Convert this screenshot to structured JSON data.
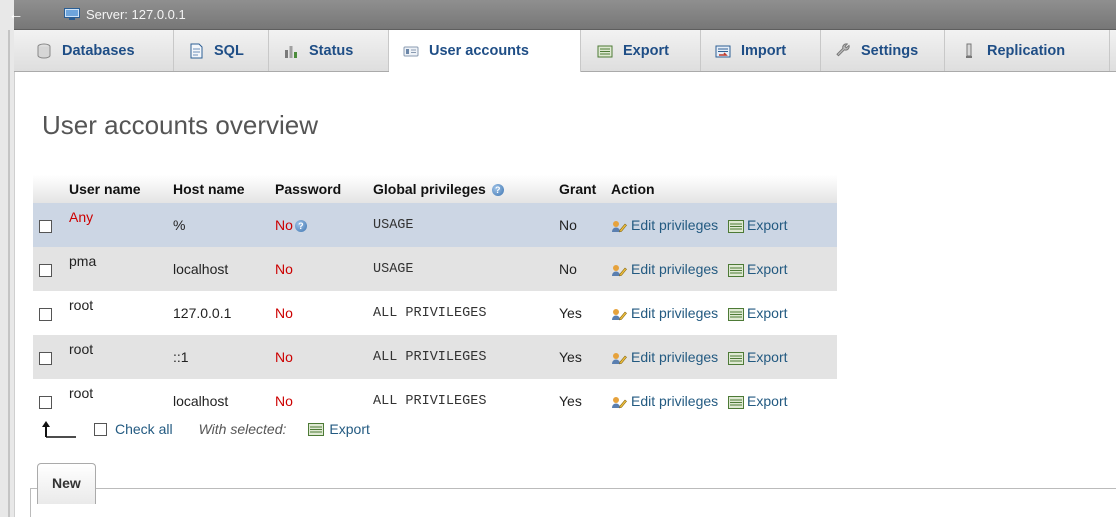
{
  "topbar": {
    "back_label": "←",
    "server_label": "Server: 127.0.0.1"
  },
  "tabs": [
    {
      "label": "Databases",
      "icon": "database-icon"
    },
    {
      "label": "SQL",
      "icon": "sql-icon"
    },
    {
      "label": "Status",
      "icon": "status-chart-icon"
    },
    {
      "label": "User accounts",
      "icon": "users-icon",
      "active": true
    },
    {
      "label": "Export",
      "icon": "export-icon"
    },
    {
      "label": "Import",
      "icon": "import-icon"
    },
    {
      "label": "Settings",
      "icon": "wrench-icon"
    },
    {
      "label": "Replication",
      "icon": "replication-icon"
    }
  ],
  "page": {
    "title": "User accounts overview"
  },
  "table": {
    "headers": [
      "User name",
      "Host name",
      "Password",
      "Global privileges",
      "Grant",
      "Action"
    ],
    "rows": [
      {
        "user": "Any",
        "host": "%",
        "password": "No",
        "privileges": "USAGE",
        "grant": "No",
        "edit": "Edit privileges",
        "export": "Export"
      },
      {
        "user": "pma",
        "host": "localhost",
        "password": "No",
        "privileges": "USAGE",
        "grant": "No",
        "edit": "Edit privileges",
        "export": "Export"
      },
      {
        "user": "root",
        "host": "127.0.0.1",
        "password": "No",
        "privileges": "ALL PRIVILEGES",
        "grant": "Yes",
        "edit": "Edit privileges",
        "export": "Export"
      },
      {
        "user": "root",
        "host": "::1",
        "password": "No",
        "privileges": "ALL PRIVILEGES",
        "grant": "Yes",
        "edit": "Edit privileges",
        "export": "Export"
      },
      {
        "user": "root",
        "host": "localhost",
        "password": "No",
        "privileges": "ALL PRIVILEGES",
        "grant": "Yes",
        "edit": "Edit privileges",
        "export": "Export"
      }
    ]
  },
  "footer": {
    "check_all": "Check all",
    "with_selected": "With selected:",
    "export": "Export"
  },
  "new_section": {
    "legend": "New"
  },
  "colors": {
    "link": "#235a81",
    "tab_text": "#1f4e86",
    "no_password": "#cc0000",
    "highlight_row": "#ccd6e4",
    "even_row": "#e3e3e3"
  }
}
